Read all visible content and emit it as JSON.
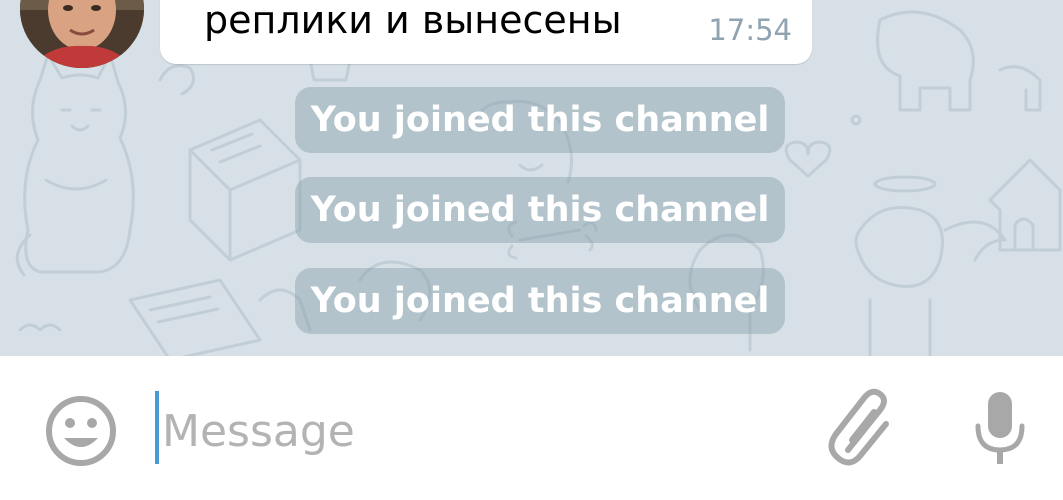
{
  "chat": {
    "background_color": "#d6e0e6",
    "message": {
      "text": "реплики и вынесены",
      "time": "17:54"
    },
    "service_messages": [
      "You joined this channel",
      "You joined this channel",
      "You joined this channel"
    ]
  },
  "composer": {
    "placeholder": "Message",
    "cursor_color": "#4a9ad8",
    "icon_color": "#a8a8a8",
    "icons": {
      "emoji": "smiley-icon",
      "attach": "paperclip-icon",
      "voice": "microphone-icon"
    }
  }
}
